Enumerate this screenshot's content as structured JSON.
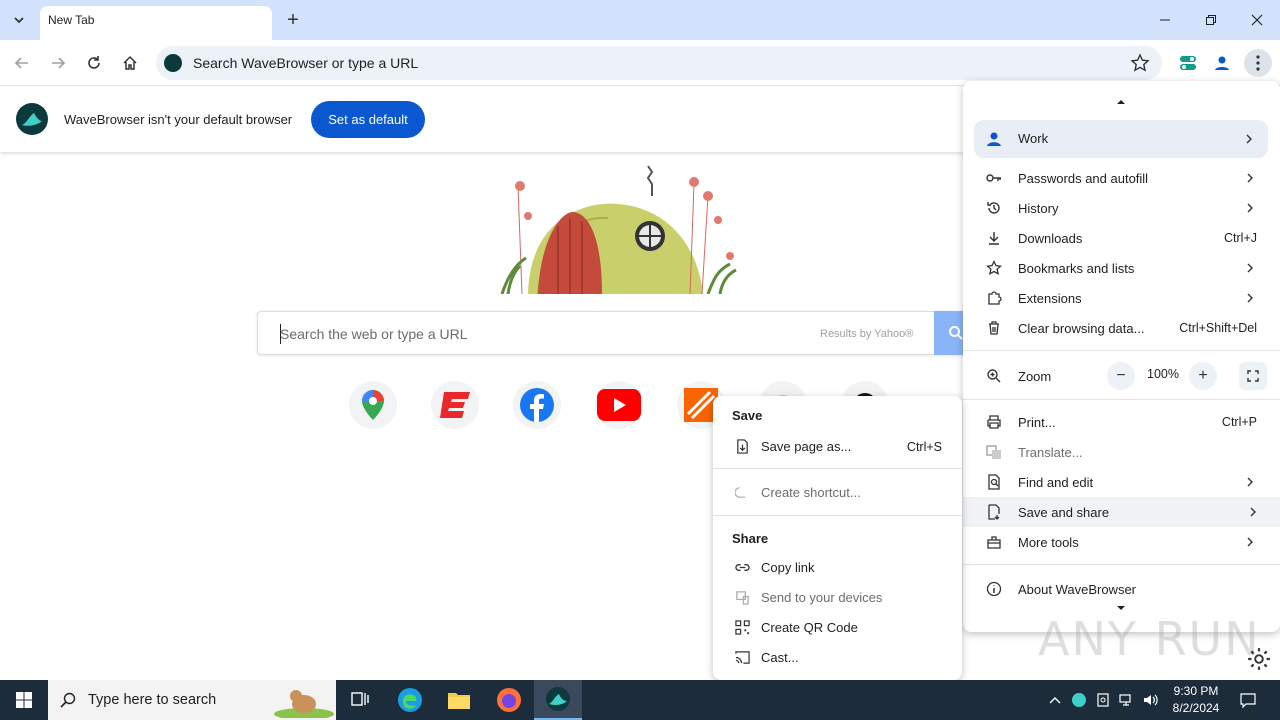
{
  "tabstrip": {
    "tab_title": "New Tab",
    "new_tab": "+"
  },
  "toolbar": {
    "omnibox_text": "Search WaveBrowser or type a URL"
  },
  "infobar": {
    "message": "WaveBrowser isn't your default browser",
    "button": "Set as default"
  },
  "page": {
    "search_placeholder": "Search the web or type a URL",
    "search_provider": "Results by Yahoo®",
    "shortcuts": [
      "google-maps",
      "espn",
      "facebook",
      "youtube",
      "the-home-depot",
      "unknown-shortcut",
      "unknown-shortcut-2"
    ]
  },
  "main_menu": {
    "profile": "Work",
    "items": [
      {
        "label": "Passwords and autofill",
        "shortcut": ""
      },
      {
        "label": "History",
        "shortcut": ""
      },
      {
        "label": "Downloads",
        "shortcut": "Ctrl+J"
      },
      {
        "label": "Bookmarks and lists",
        "shortcut": ""
      },
      {
        "label": "Extensions",
        "shortcut": ""
      },
      {
        "label": "Clear browsing data...",
        "shortcut": "Ctrl+Shift+Del"
      }
    ],
    "zoom_label": "Zoom",
    "zoom_value": "100%",
    "zoom_minus": "−",
    "zoom_plus": "+",
    "items2": [
      {
        "label": "Print...",
        "shortcut": "Ctrl+P"
      },
      {
        "label": "Translate...",
        "shortcut": ""
      },
      {
        "label": "Find and edit",
        "shortcut": ""
      },
      {
        "label": "Save and share",
        "shortcut": ""
      },
      {
        "label": "More tools",
        "shortcut": ""
      }
    ],
    "about": "About WaveBrowser"
  },
  "sub_menu": {
    "save_heading": "Save",
    "save_page": "Save page as...",
    "save_page_shortcut": "Ctrl+S",
    "create_shortcut": "Create shortcut...",
    "share_heading": "Share",
    "copy_link": "Copy link",
    "send_devices": "Send to your devices",
    "qr_code": "Create QR Code",
    "cast": "Cast..."
  },
  "watermark": "ANY RUN",
  "taskbar": {
    "search_placeholder": "Type here to search",
    "time": "9:30 PM",
    "date": "8/2/2024"
  },
  "colors": {
    "accent": "#0b57d0",
    "tabstrip": "#d3e3fd",
    "taskbar": "#1d2c3b"
  }
}
